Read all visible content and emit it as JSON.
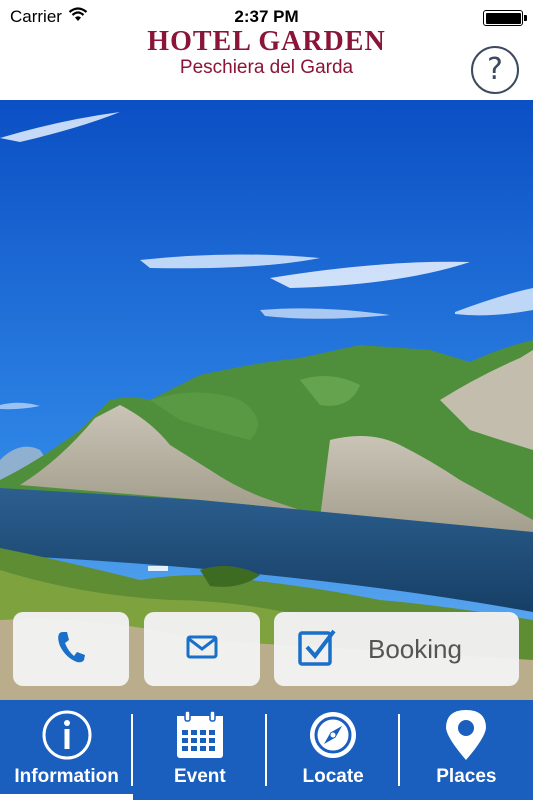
{
  "status_bar": {
    "carrier": "Carrier",
    "time": "2:37 PM",
    "wifi_icon": "wifi-icon",
    "battery_icon": "battery-icon"
  },
  "header": {
    "title": "HOTEL GARDEN",
    "subtitle": "Peschiera del Garda",
    "help_label": "?",
    "brand_color": "#8a1538"
  },
  "hero": {
    "image": "lake-garda-mountains-photo"
  },
  "actions": {
    "phone_icon": "phone-icon",
    "mail_icon": "mail-icon",
    "booking_icon": "checkbox-icon",
    "booking_label": "Booking",
    "accent_color": "#1a6fc9"
  },
  "tabbar": {
    "background": "#1a5fbd",
    "active_index": 0,
    "tabs": [
      {
        "label": "Information",
        "icon": "info-icon"
      },
      {
        "label": "Event",
        "icon": "calendar-icon"
      },
      {
        "label": "Locate",
        "icon": "compass-icon"
      },
      {
        "label": "Places",
        "icon": "map-pin-icon"
      }
    ]
  }
}
